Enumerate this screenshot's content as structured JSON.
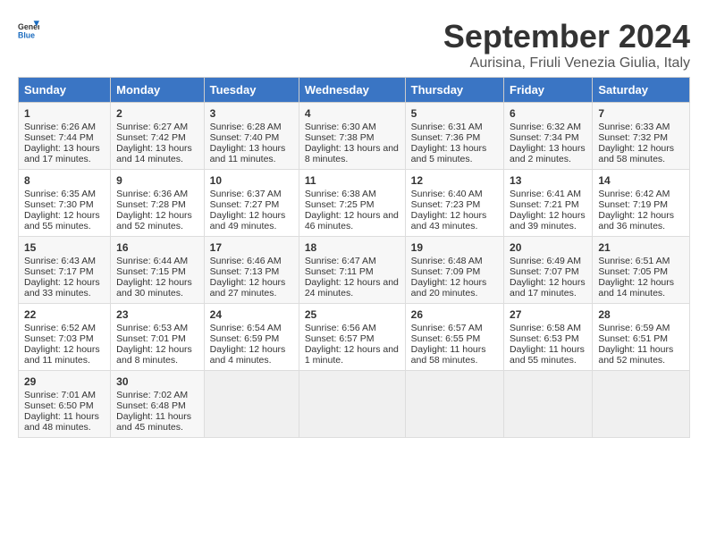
{
  "logo": {
    "general": "General",
    "blue": "Blue"
  },
  "title": "September 2024",
  "subtitle": "Aurisina, Friuli Venezia Giulia, Italy",
  "days_of_week": [
    "Sunday",
    "Monday",
    "Tuesday",
    "Wednesday",
    "Thursday",
    "Friday",
    "Saturday"
  ],
  "weeks": [
    [
      {
        "day": "1",
        "sunrise": "Sunrise: 6:26 AM",
        "sunset": "Sunset: 7:44 PM",
        "daylight": "Daylight: 13 hours and 17 minutes."
      },
      {
        "day": "2",
        "sunrise": "Sunrise: 6:27 AM",
        "sunset": "Sunset: 7:42 PM",
        "daylight": "Daylight: 13 hours and 14 minutes."
      },
      {
        "day": "3",
        "sunrise": "Sunrise: 6:28 AM",
        "sunset": "Sunset: 7:40 PM",
        "daylight": "Daylight: 13 hours and 11 minutes."
      },
      {
        "day": "4",
        "sunrise": "Sunrise: 6:30 AM",
        "sunset": "Sunset: 7:38 PM",
        "daylight": "Daylight: 13 hours and 8 minutes."
      },
      {
        "day": "5",
        "sunrise": "Sunrise: 6:31 AM",
        "sunset": "Sunset: 7:36 PM",
        "daylight": "Daylight: 13 hours and 5 minutes."
      },
      {
        "day": "6",
        "sunrise": "Sunrise: 6:32 AM",
        "sunset": "Sunset: 7:34 PM",
        "daylight": "Daylight: 13 hours and 2 minutes."
      },
      {
        "day": "7",
        "sunrise": "Sunrise: 6:33 AM",
        "sunset": "Sunset: 7:32 PM",
        "daylight": "Daylight: 12 hours and 58 minutes."
      }
    ],
    [
      {
        "day": "8",
        "sunrise": "Sunrise: 6:35 AM",
        "sunset": "Sunset: 7:30 PM",
        "daylight": "Daylight: 12 hours and 55 minutes."
      },
      {
        "day": "9",
        "sunrise": "Sunrise: 6:36 AM",
        "sunset": "Sunset: 7:28 PM",
        "daylight": "Daylight: 12 hours and 52 minutes."
      },
      {
        "day": "10",
        "sunrise": "Sunrise: 6:37 AM",
        "sunset": "Sunset: 7:27 PM",
        "daylight": "Daylight: 12 hours and 49 minutes."
      },
      {
        "day": "11",
        "sunrise": "Sunrise: 6:38 AM",
        "sunset": "Sunset: 7:25 PM",
        "daylight": "Daylight: 12 hours and 46 minutes."
      },
      {
        "day": "12",
        "sunrise": "Sunrise: 6:40 AM",
        "sunset": "Sunset: 7:23 PM",
        "daylight": "Daylight: 12 hours and 43 minutes."
      },
      {
        "day": "13",
        "sunrise": "Sunrise: 6:41 AM",
        "sunset": "Sunset: 7:21 PM",
        "daylight": "Daylight: 12 hours and 39 minutes."
      },
      {
        "day": "14",
        "sunrise": "Sunrise: 6:42 AM",
        "sunset": "Sunset: 7:19 PM",
        "daylight": "Daylight: 12 hours and 36 minutes."
      }
    ],
    [
      {
        "day": "15",
        "sunrise": "Sunrise: 6:43 AM",
        "sunset": "Sunset: 7:17 PM",
        "daylight": "Daylight: 12 hours and 33 minutes."
      },
      {
        "day": "16",
        "sunrise": "Sunrise: 6:44 AM",
        "sunset": "Sunset: 7:15 PM",
        "daylight": "Daylight: 12 hours and 30 minutes."
      },
      {
        "day": "17",
        "sunrise": "Sunrise: 6:46 AM",
        "sunset": "Sunset: 7:13 PM",
        "daylight": "Daylight: 12 hours and 27 minutes."
      },
      {
        "day": "18",
        "sunrise": "Sunrise: 6:47 AM",
        "sunset": "Sunset: 7:11 PM",
        "daylight": "Daylight: 12 hours and 24 minutes."
      },
      {
        "day": "19",
        "sunrise": "Sunrise: 6:48 AM",
        "sunset": "Sunset: 7:09 PM",
        "daylight": "Daylight: 12 hours and 20 minutes."
      },
      {
        "day": "20",
        "sunrise": "Sunrise: 6:49 AM",
        "sunset": "Sunset: 7:07 PM",
        "daylight": "Daylight: 12 hours and 17 minutes."
      },
      {
        "day": "21",
        "sunrise": "Sunrise: 6:51 AM",
        "sunset": "Sunset: 7:05 PM",
        "daylight": "Daylight: 12 hours and 14 minutes."
      }
    ],
    [
      {
        "day": "22",
        "sunrise": "Sunrise: 6:52 AM",
        "sunset": "Sunset: 7:03 PM",
        "daylight": "Daylight: 12 hours and 11 minutes."
      },
      {
        "day": "23",
        "sunrise": "Sunrise: 6:53 AM",
        "sunset": "Sunset: 7:01 PM",
        "daylight": "Daylight: 12 hours and 8 minutes."
      },
      {
        "day": "24",
        "sunrise": "Sunrise: 6:54 AM",
        "sunset": "Sunset: 6:59 PM",
        "daylight": "Daylight: 12 hours and 4 minutes."
      },
      {
        "day": "25",
        "sunrise": "Sunrise: 6:56 AM",
        "sunset": "Sunset: 6:57 PM",
        "daylight": "Daylight: 12 hours and 1 minute."
      },
      {
        "day": "26",
        "sunrise": "Sunrise: 6:57 AM",
        "sunset": "Sunset: 6:55 PM",
        "daylight": "Daylight: 11 hours and 58 minutes."
      },
      {
        "day": "27",
        "sunrise": "Sunrise: 6:58 AM",
        "sunset": "Sunset: 6:53 PM",
        "daylight": "Daylight: 11 hours and 55 minutes."
      },
      {
        "day": "28",
        "sunrise": "Sunrise: 6:59 AM",
        "sunset": "Sunset: 6:51 PM",
        "daylight": "Daylight: 11 hours and 52 minutes."
      }
    ],
    [
      {
        "day": "29",
        "sunrise": "Sunrise: 7:01 AM",
        "sunset": "Sunset: 6:50 PM",
        "daylight": "Daylight: 11 hours and 48 minutes."
      },
      {
        "day": "30",
        "sunrise": "Sunrise: 7:02 AM",
        "sunset": "Sunset: 6:48 PM",
        "daylight": "Daylight: 11 hours and 45 minutes."
      },
      null,
      null,
      null,
      null,
      null
    ]
  ]
}
